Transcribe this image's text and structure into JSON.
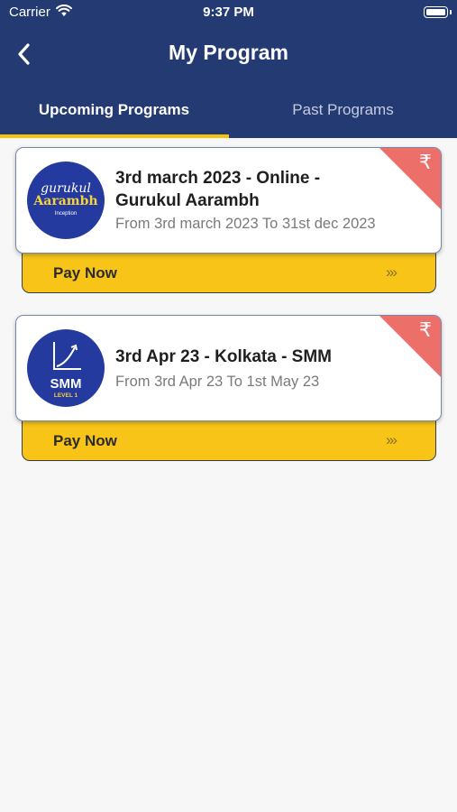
{
  "status_bar": {
    "carrier": "Carrier",
    "time": "9:37 PM"
  },
  "header": {
    "title": "My Program"
  },
  "tabs": [
    {
      "label": "Upcoming Programs",
      "selected": true
    },
    {
      "label": "Past Programs",
      "selected": false
    }
  ],
  "programs": [
    {
      "title": "3rd march 2023 - Online - Gurukul Aarambh",
      "dates": "From 3rd march 2023 To 31st dec 2023",
      "pay_label": "Pay Now",
      "pay_arrows": "›››",
      "badge": "₹",
      "logo": {
        "line1": "gurukul",
        "line2": "Aarambh",
        "line3": "Inception"
      }
    },
    {
      "title": "3rd Apr 23 - Kolkata - SMM",
      "dates": "From 3rd Apr 23 To 1st May 23",
      "pay_label": "Pay Now",
      "pay_arrows": "›››",
      "badge": "₹",
      "logo": {
        "line1": "SMM",
        "line2": "LEVEL 1"
      }
    }
  ],
  "colors": {
    "header_bg": "#233a72",
    "tab_indicator": "#f6c20c",
    "pay_bar": "#f7c417",
    "badge": "#ec6f6a",
    "logo_bg": "#253a9e"
  },
  "icons": {
    "back": "chevron-left-icon",
    "wifi": "wifi-icon",
    "battery": "battery-icon",
    "badge": "rupee-icon",
    "pay": "triple-chevron-right-icon"
  }
}
